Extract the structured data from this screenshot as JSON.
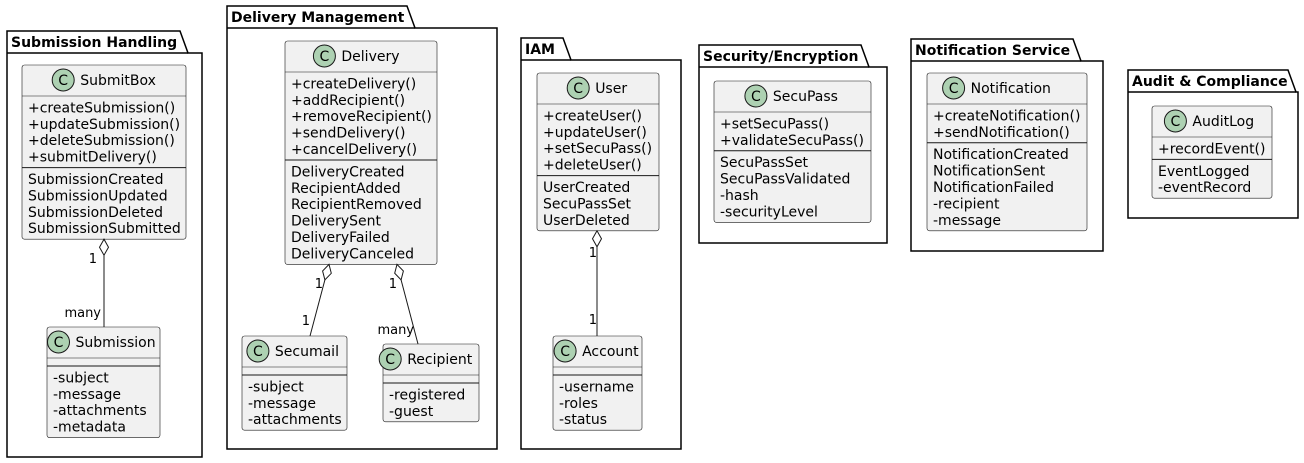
{
  "colors": {
    "class_fill": "#F1F1F1",
    "class_border": "#181818",
    "stereo_circle": "#ADD1B2",
    "stereo_letter": "#000000",
    "package_border": "#000000",
    "line": "#181818"
  },
  "stereotype_letter": "C",
  "packages": [
    {
      "id": "submission",
      "title": "Submission Handling",
      "classes": [
        {
          "id": "submitbox",
          "name": "SubmitBox",
          "methods": [
            "+createSubmission()",
            "+updateSubmission()",
            "+deleteSubmission()",
            "+submitDelivery()"
          ],
          "fields": [
            "SubmissionCreated",
            "SubmissionUpdated",
            "SubmissionDeleted",
            "SubmissionSubmitted"
          ]
        },
        {
          "id": "submission",
          "name": "Submission",
          "methods": [],
          "fields": [
            "-subject",
            "-message",
            "-attachments",
            "-metadata"
          ]
        }
      ]
    },
    {
      "id": "delivery",
      "title": "Delivery Management",
      "classes": [
        {
          "id": "delivery",
          "name": "Delivery",
          "methods": [
            "+createDelivery()",
            "+addRecipient()",
            "+removeRecipient()",
            "+sendDelivery()",
            "+cancelDelivery()"
          ],
          "fields": [
            "DeliveryCreated",
            "RecipientAdded",
            "RecipientRemoved",
            "DeliverySent",
            "DeliveryFailed",
            "DeliveryCanceled"
          ]
        },
        {
          "id": "secumail",
          "name": "Secumail",
          "methods": [],
          "fields": [
            "-subject",
            "-message",
            "-attachments"
          ]
        },
        {
          "id": "recipient",
          "name": "Recipient",
          "methods": [],
          "fields": [
            "-registered",
            "-guest"
          ]
        }
      ]
    },
    {
      "id": "iam",
      "title": "IAM",
      "classes": [
        {
          "id": "user",
          "name": "User",
          "methods": [
            "+createUser()",
            "+updateUser()",
            "+setSecuPass()",
            "+deleteUser()"
          ],
          "fields": [
            "UserCreated",
            "SecuPassSet",
            "UserDeleted"
          ]
        },
        {
          "id": "account",
          "name": "Account",
          "methods": [],
          "fields": [
            "-username",
            "-roles",
            "-status"
          ]
        }
      ]
    },
    {
      "id": "security",
      "title": "Security/Encryption",
      "classes": [
        {
          "id": "secupass",
          "name": "SecuPass",
          "methods": [
            "+setSecuPass()",
            "+validateSecuPass()"
          ],
          "fields": [
            "SecuPassSet",
            "SecuPassValidated",
            "-hash",
            "-securityLevel"
          ]
        }
      ]
    },
    {
      "id": "notification",
      "title": "Notification Service",
      "classes": [
        {
          "id": "notification",
          "name": "Notification",
          "methods": [
            "+createNotification()",
            "+sendNotification()"
          ],
          "fields": [
            "NotificationCreated",
            "NotificationSent",
            "NotificationFailed",
            "-recipient",
            "-message"
          ]
        }
      ]
    },
    {
      "id": "audit",
      "title": "Audit & Compliance",
      "classes": [
        {
          "id": "auditlog",
          "name": "AuditLog",
          "methods": [
            "+recordEvent()"
          ],
          "fields": [
            "EventLogged",
            "-eventRecord"
          ]
        }
      ]
    }
  ],
  "relations": [
    {
      "id": "submitbox-submission",
      "from": "submitbox",
      "to": "submission",
      "from_label": "1",
      "to_label": "many",
      "type": "aggregation"
    },
    {
      "id": "delivery-secumail",
      "from": "delivery",
      "to": "secumail",
      "from_label": "1",
      "to_label": "1",
      "type": "aggregation"
    },
    {
      "id": "delivery-recipient",
      "from": "delivery",
      "to": "recipient",
      "from_label": "1",
      "to_label": "many",
      "type": "aggregation"
    },
    {
      "id": "user-account",
      "from": "user",
      "to": "account",
      "from_label": "1",
      "to_label": "1",
      "type": "aggregation"
    }
  ]
}
